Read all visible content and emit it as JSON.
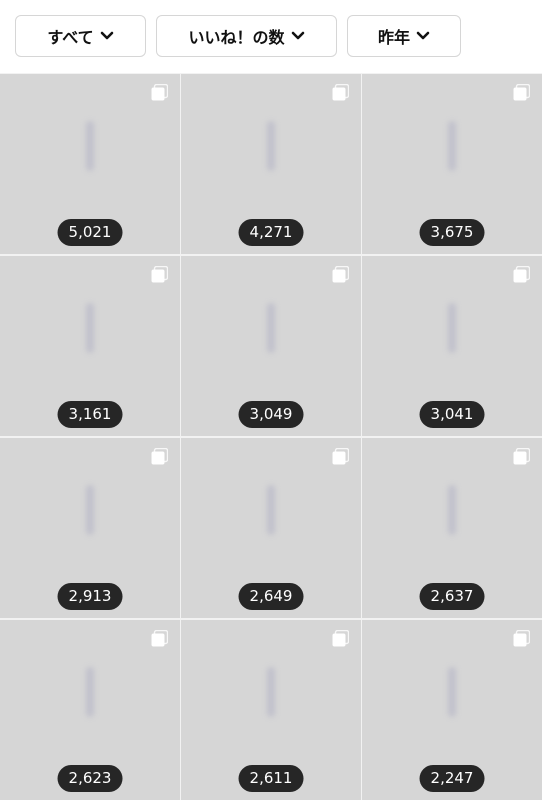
{
  "filters": [
    {
      "label": "すべて"
    },
    {
      "label": "いいね！の数"
    },
    {
      "label": "昨年"
    }
  ],
  "posts": [
    {
      "count": "5,021"
    },
    {
      "count": "4,271"
    },
    {
      "count": "3,675"
    },
    {
      "count": "3,161"
    },
    {
      "count": "3,049"
    },
    {
      "count": "3,041"
    },
    {
      "count": "2,913"
    },
    {
      "count": "2,649"
    },
    {
      "count": "2,637"
    },
    {
      "count": "2,623"
    },
    {
      "count": "2,611"
    },
    {
      "count": "2,247"
    }
  ]
}
